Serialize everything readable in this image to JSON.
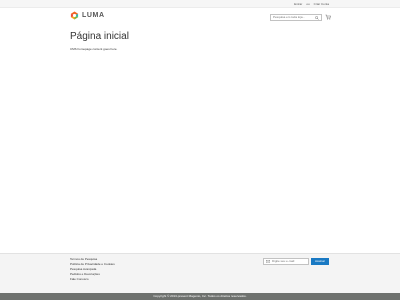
{
  "panel": {
    "links": [
      "Entrar",
      "ou",
      "Criar Conta"
    ]
  },
  "header": {
    "logo_text": "LUMA",
    "search_placeholder": "Pesquisa em toda loja...",
    "brand_colors": {
      "orange": "#f26322",
      "teal": "#2bb9ae",
      "green": "#7cb342"
    }
  },
  "main": {
    "title": "Página inicial",
    "note": "CMS homepage content goes here."
  },
  "footer": {
    "links": [
      "Termos de Pesquisa",
      "Política de Privacidade e Cookies",
      "Pesquisa Avançada",
      "Pedidos e Devoluções",
      "Fale Conosco"
    ],
    "newsletter_placeholder": "Digite seu e-mail",
    "newsletter_button": "Assinar",
    "accent_color": "#1979c3"
  },
  "copyright": "Copyright © 2013-present Magento, Inc. Todos os direitos reservados."
}
